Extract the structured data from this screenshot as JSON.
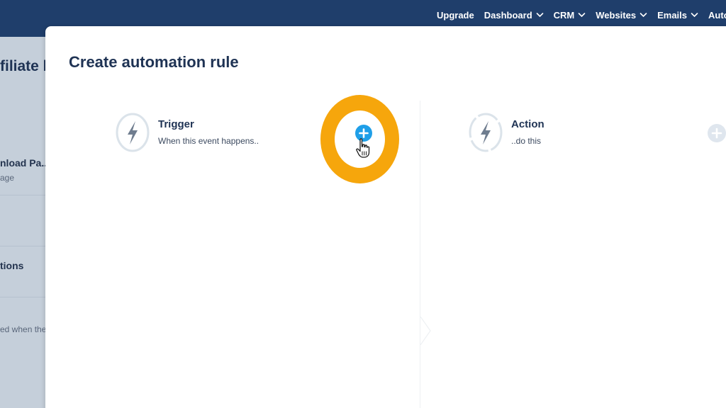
{
  "nav": {
    "items": [
      {
        "label": "Upgrade",
        "has_dropdown": false
      },
      {
        "label": "Dashboard",
        "has_dropdown": true
      },
      {
        "label": "CRM",
        "has_dropdown": true
      },
      {
        "label": "Websites",
        "has_dropdown": true
      },
      {
        "label": "Emails",
        "has_dropdown": true
      },
      {
        "label": "Automatio",
        "has_dropdown": false
      }
    ]
  },
  "background_page": {
    "title": "filiate la",
    "rows": [
      {
        "title": "nload Pa...",
        "subtitle": "age"
      },
      {
        "title": "",
        "subtitle": ""
      },
      {
        "title": "tions",
        "subtitle": ""
      },
      {
        "title": "",
        "subtitle": "ed when the"
      }
    ]
  },
  "modal": {
    "title": "Create automation rule",
    "trigger": {
      "title": "Trigger",
      "subtitle": "When this event happens..",
      "icon": "lightning-icon"
    },
    "action": {
      "title": "Action",
      "subtitle": "..do this",
      "icon": "lightning-icon"
    },
    "add_trigger_icon": "plus-icon",
    "add_action_icon": "plus-icon"
  },
  "colors": {
    "nav_bg": "#1f3e6b",
    "highlight": "#f6a60c",
    "add_button": "#1f9fe8",
    "title_text": "#1f3354"
  }
}
